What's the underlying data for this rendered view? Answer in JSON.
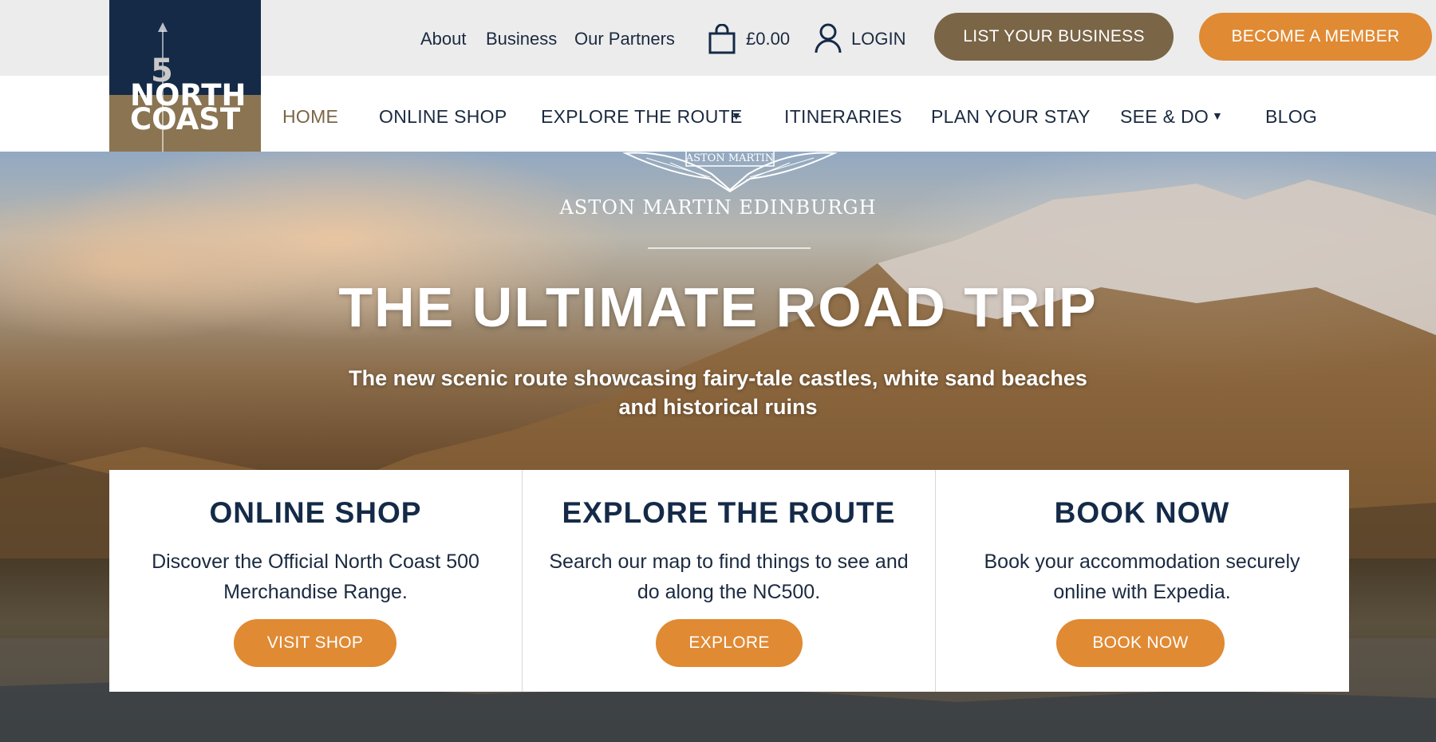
{
  "brand": {
    "logo_number": "5",
    "logo_line1": "NORTH",
    "logo_line2": "COAST"
  },
  "utility": {
    "about": "About",
    "business": "Business",
    "partners": "Our Partners",
    "cart_total": "£0.00",
    "login": "LOGIN",
    "list_business": "LIST YOUR BUSINESS",
    "become_member": "BECOME A MEMBER"
  },
  "nav": {
    "items": [
      {
        "label": "HOME"
      },
      {
        "label": "ONLINE SHOP"
      },
      {
        "label": "EXPLORE THE ROUTE"
      },
      {
        "label": "ITINERARIES"
      },
      {
        "label": "PLAN YOUR STAY"
      },
      {
        "label": "SEE & DO"
      },
      {
        "label": "BLOG"
      }
    ],
    "caret": "▼"
  },
  "hero": {
    "sponsor_badge": "ASTON MARTIN",
    "sponsor": "ASTON MARTIN EDINBURGH",
    "headline": "THE ULTIMATE ROAD TRIP",
    "subline_1": "The new scenic route showcasing fairy-tale castles, white sand beaches",
    "subline_2": "and historical ruins"
  },
  "cards": [
    {
      "title": "ONLINE SHOP",
      "desc_1": "Discover the Official North Coast 500",
      "desc_2": "Merchandise Range.",
      "button": "VISIT SHOP"
    },
    {
      "title": "EXPLORE THE ROUTE",
      "desc_1": "Search our map to find things to see and",
      "desc_2": "do along the NC500.",
      "button": "EXPLORE"
    },
    {
      "title": "BOOK NOW",
      "desc_1": "Book your accommodation securely",
      "desc_2": "online with Expedia.",
      "button": "BOOK NOW"
    }
  ],
  "colors": {
    "navy": "#142a47",
    "brown": "#7a6547",
    "orange": "#e08a33"
  }
}
